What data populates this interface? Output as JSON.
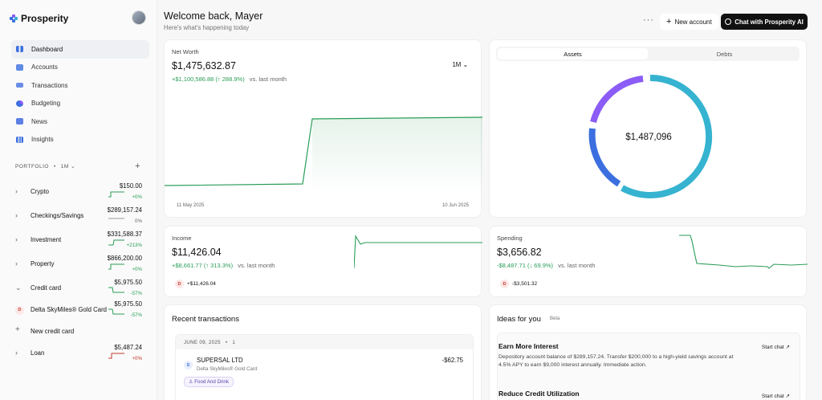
{
  "app": {
    "name": "Prosperity"
  },
  "nav": [
    {
      "label": "Dashboard",
      "icon": "grid-icon",
      "active": true
    },
    {
      "label": "Accounts",
      "icon": "layers-icon"
    },
    {
      "label": "Transactions",
      "icon": "list-icon"
    },
    {
      "label": "Budgeting",
      "icon": "pie-icon"
    },
    {
      "label": "News",
      "icon": "newspaper-icon"
    },
    {
      "label": "Insights",
      "icon": "bar-chart-icon"
    }
  ],
  "portfolio": {
    "label": "PORTFOLIO",
    "period": "1M",
    "accounts": [
      {
        "name": "Crypto",
        "amount": "$150.00",
        "delta": "+0%"
      },
      {
        "name": "Checkings/Savings",
        "amount": "$289,157.24",
        "delta": "0%"
      },
      {
        "name": "Investment",
        "amount": "$331,588.37",
        "delta": "+213%"
      },
      {
        "name": "Property",
        "amount": "$866,200.00",
        "delta": "+0%"
      },
      {
        "name": "Credit card",
        "amount": "$5,975.50",
        "delta": "-57%"
      },
      {
        "name": "Delta SkyMiles® Gold Card",
        "amount": "$5,975.50",
        "delta": "-57%",
        "badge": "D"
      },
      {
        "name": "New credit card"
      },
      {
        "name": "Loan",
        "amount": "$5,487.24",
        "delta": "+0%"
      }
    ]
  },
  "header": {
    "title": "Welcome back, Mayer",
    "subtitle": "Here's what's happening today",
    "more": "···",
    "new_account": "New account",
    "chat": "Chat with Prosperity AI"
  },
  "net_worth": {
    "label": "Net Worth",
    "value": "$1,475,632.87",
    "change": "+$1,100,586.88 (↑ 288.9%)",
    "vs": "vs. last month",
    "period": "1M",
    "start_date": "11 May 2025",
    "end_date": "10 Jun 2025"
  },
  "assets": {
    "tabs": [
      "Assets",
      "Debts"
    ],
    "total": "$1,487,096",
    "colors": {
      "start": "#8b5cf6",
      "mid": "#3b6fe0",
      "end": "#35b3d0"
    }
  },
  "income": {
    "label": "Income",
    "value": "$11,426.04",
    "change": "+$8,661.77 (↑ 313.3%)",
    "vs": "vs. last month",
    "badge": "D",
    "badge_value": "+$11,426.04"
  },
  "spending": {
    "label": "Spending",
    "value": "$3,656.82",
    "change": "-$8,487.71 (↓ 69.9%)",
    "vs": "vs. last month",
    "badge": "D",
    "badge_value": "-$3,501.32"
  },
  "recent": {
    "title": "Recent transactions",
    "date": "JUNE 09, 2025",
    "count": "1",
    "txn": {
      "badge": "S",
      "merchant": "SUPERSAL LTD",
      "account": "Delta SkyMiles® Gold Card",
      "amount": "-$62.75",
      "category": "Food And Drink"
    }
  },
  "ideas": {
    "title": "Ideas for you",
    "beta": "Beta",
    "items": [
      {
        "title": "Earn More Interest",
        "desc": "Depository account balance of $289,157.24. Transfer $200,000 to a high-yield savings account at 4.5% APY to earn $9,000 interest annually. Immediate action.",
        "action": "Start chat"
      },
      {
        "title": "Reduce Credit Utilization",
        "action": "Start chat"
      }
    ]
  },
  "colors": {
    "accent_green": "#2a9d57",
    "negative_red": "#c0392b"
  }
}
